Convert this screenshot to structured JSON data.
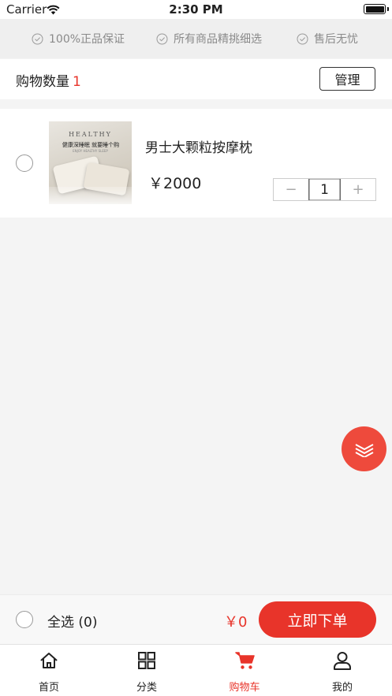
{
  "status_bar": {
    "carrier": "Carrier",
    "time": "2:30 PM"
  },
  "guarantees": [
    "100%正品保证",
    "所有商品精挑细选",
    "售后无忧"
  ],
  "cart_header": {
    "label": "购物数量",
    "count": "1",
    "manage_label": "管理"
  },
  "cart_items": [
    {
      "name": "男士大颗粒按摩枕",
      "price": "￥2000",
      "quantity": "1",
      "decrement": "−",
      "increment": "+",
      "image": {
        "brand": "HEALTHY",
        "slogan": "健康深睡眠 就要睡个购",
        "subtext": "ENJOY HEALTHY SLEEP"
      }
    }
  ],
  "checkout": {
    "select_all": "全选 (0)",
    "total": "￥0",
    "order_label": "立即下单"
  },
  "tabs": [
    {
      "label": "首页",
      "icon": "home-icon",
      "active": false
    },
    {
      "label": "分类",
      "icon": "grid-icon",
      "active": false
    },
    {
      "label": "购物车",
      "icon": "cart-icon",
      "active": true
    },
    {
      "label": "我的",
      "icon": "user-icon",
      "active": false
    }
  ],
  "colors": {
    "accent": "#e8342a",
    "float_button": "#ee4a3c",
    "guarantee_text": "#8a8a8a",
    "background": "#f4f4f4"
  }
}
